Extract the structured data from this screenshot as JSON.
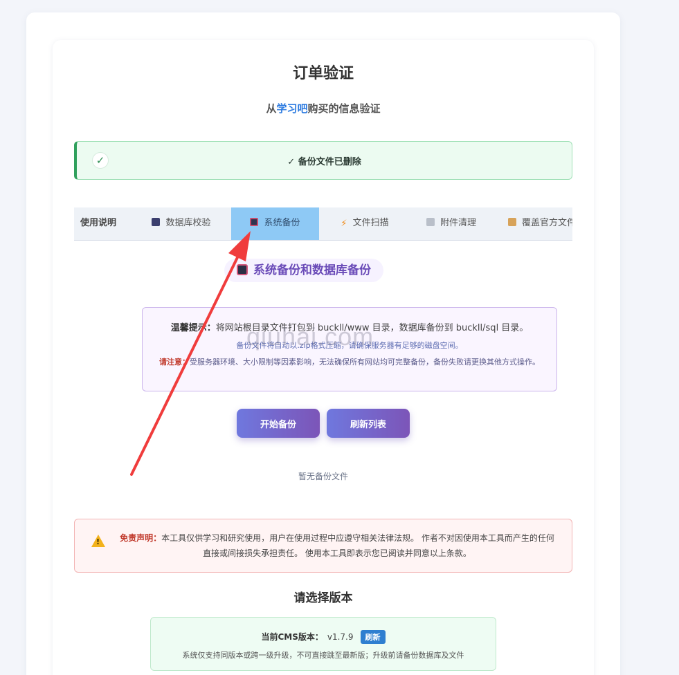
{
  "header": {
    "title": "订单验证",
    "subtitle_prefix": "从",
    "subtitle_brand": "学习吧",
    "subtitle_suffix": "购买的信息验证"
  },
  "alert": {
    "icon": "check-icon",
    "check_glyph": "✓",
    "message": "✓ 备份文件已删除"
  },
  "tabs": [
    {
      "label": "使用说明",
      "icon": ""
    },
    {
      "label": "数据库校验",
      "icon": "database-icon"
    },
    {
      "label": "系统备份",
      "icon": "floppy-icon",
      "active": true
    },
    {
      "label": "文件扫描",
      "icon": "bolt-icon"
    },
    {
      "label": "附件清理",
      "icon": "trash-icon"
    },
    {
      "label": "覆盖官方文件",
      "icon": "package-icon"
    }
  ],
  "section": {
    "title": "系统备份和数据库备份"
  },
  "tip": {
    "label1": "温馨提示：",
    "text1": "将网站根目录文件打包到 buckll/www 目录，数据库备份到 buckll/sql 目录。",
    "text2": "备份文件将自动以.zip格式压缩，请确保服务器有足够的磁盘空间。",
    "label3": "请注意：",
    "text3": "受服务器环境、大小限制等因素影响，无法确保所有网站均可完整备份，备份失败请更换其他方式操作。"
  },
  "buttons": {
    "start_backup": "开始备份",
    "refresh_list": "刷新列表"
  },
  "empty_text": "暂无备份文件",
  "disclaimer": {
    "label": "免责声明：",
    "text": "本工具仅供学习和研究使用，用户在使用过程中应遵守相关法律法规。 作者不对因使用本工具而产生的任何直接或间接损失承担责任。 使用本工具即表示您已阅读并同意以上条款。"
  },
  "version": {
    "heading": "请选择版本",
    "label": "当前CMS版本：",
    "value": "v1.7.9",
    "refresh": "刷新",
    "note": "系统仅支持同版本或跨一级升级，不可直接跳至最新版；升级前请备份数据库及文件"
  },
  "watermark": "qiuhai.com",
  "colors": {
    "accent": "#8ec9f5",
    "success_border": "#2fa05c",
    "button_start": "#6f78de",
    "button_end": "#7c55b8",
    "danger": "#c0392b",
    "arrow": "#f03c3c"
  }
}
